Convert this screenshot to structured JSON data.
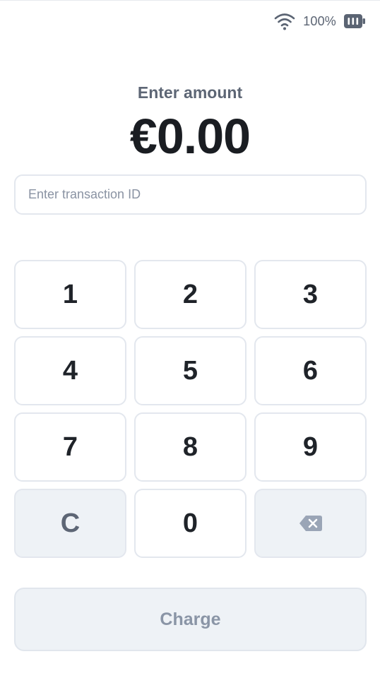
{
  "status_bar": {
    "wifi_icon": "wifi-icon",
    "battery_percent": "100%",
    "battery_icon": "battery-icon"
  },
  "amount": {
    "label": "Enter amount",
    "value": "€0.00"
  },
  "transaction_input": {
    "value": "",
    "placeholder": "Enter transaction ID"
  },
  "keypad": {
    "keys": [
      "1",
      "2",
      "3",
      "4",
      "5",
      "6",
      "7",
      "8",
      "9",
      "C",
      "0"
    ],
    "backspace_icon": "backspace-icon"
  },
  "charge": {
    "label": "Charge"
  },
  "colors": {
    "text_primary": "#1a1d22",
    "text_muted": "#5d6675",
    "border": "#e3e7ee",
    "muted_bg": "#eef2f6",
    "disabled_text": "#8a95a6",
    "icon": "#5b6473"
  }
}
